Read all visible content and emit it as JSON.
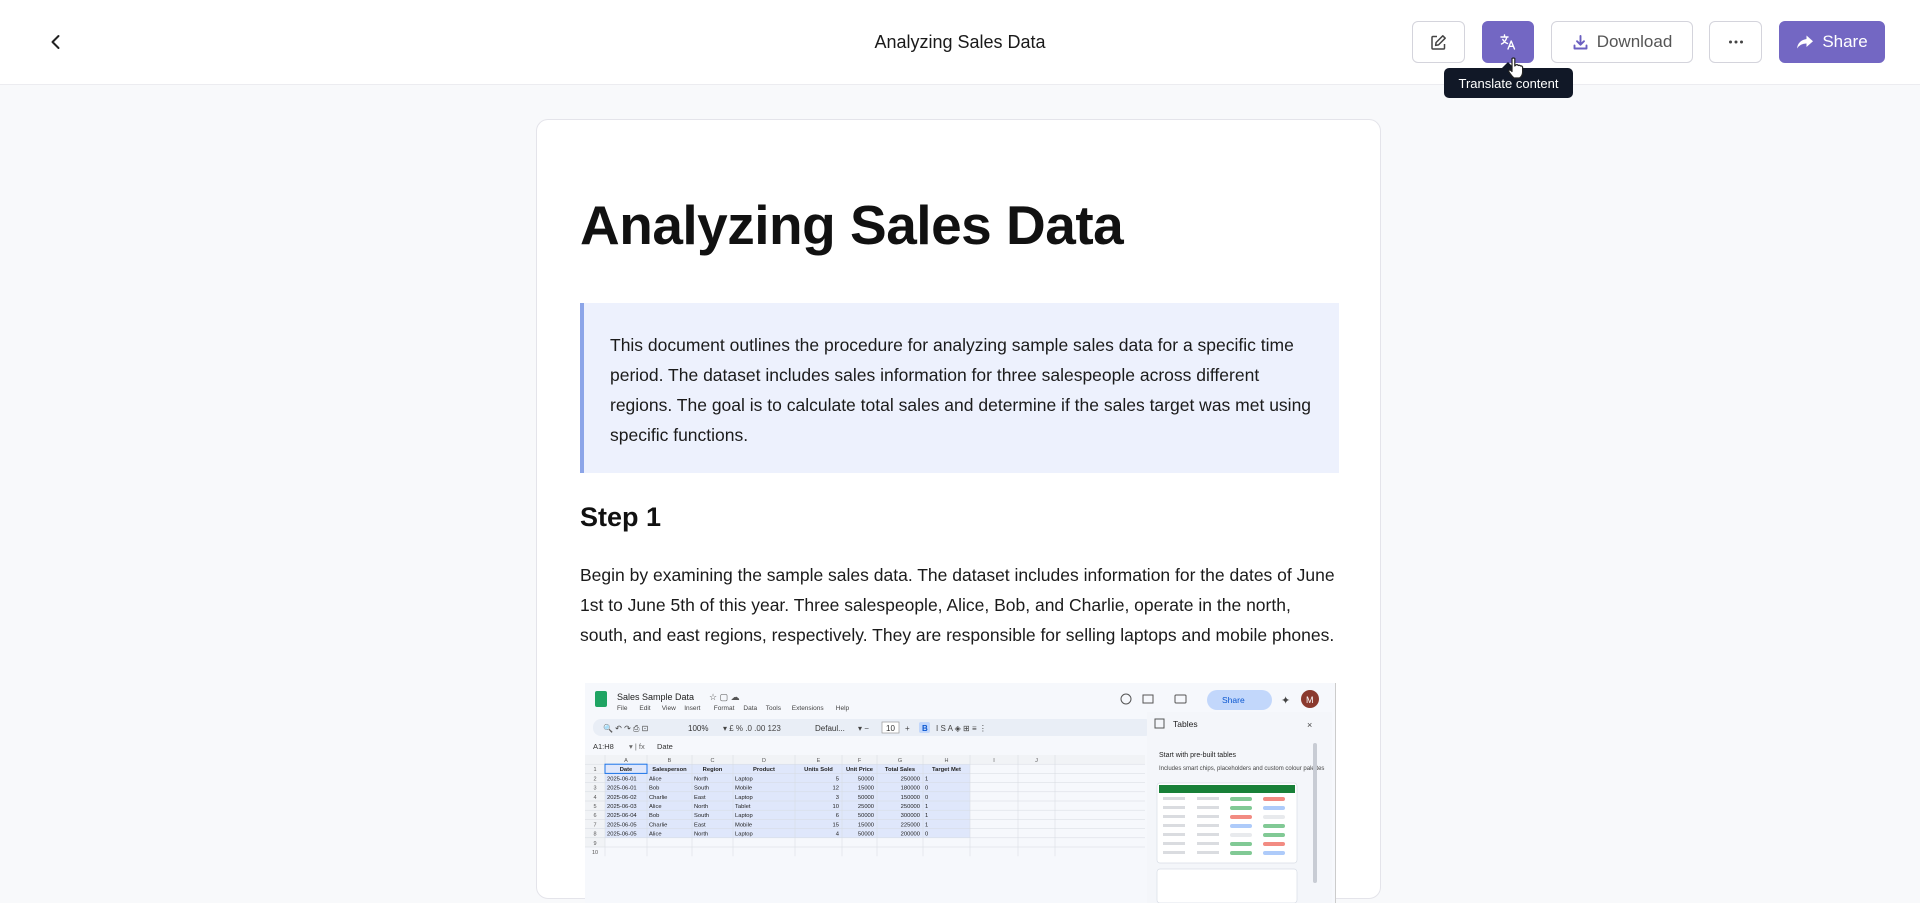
{
  "header": {
    "title": "Analyzing Sales Data",
    "download_label": "Download",
    "share_label": "Share",
    "tooltip": "Translate content"
  },
  "colors": {
    "accent": "#7367c3",
    "callout_bg": "#edf1fd",
    "callout_border": "#8ca5e8",
    "tooltip_bg": "#111827"
  },
  "icons": [
    "chevron-left-icon",
    "edit-icon",
    "translate-icon",
    "download-icon",
    "more-icon",
    "share-icon",
    "cursor-icon"
  ],
  "doc": {
    "title": "Analyzing Sales Data",
    "intro": "This document outlines the procedure for analyzing sample sales data for a specific time period. The dataset includes sales information for three salespeople across different regions. The goal is to calculate total sales and determine if the sales target was met using specific functions.",
    "step1_heading": "Step 1",
    "step1_text": "Begin by examining the sample sales data. The dataset includes information for the dates of June 1st to June 5th of this year. Three salespeople, Alice, Bob, and Charlie, operate in the north, south, and east regions, respectively. They are responsible for selling laptops and mobile phones."
  },
  "screenshot": {
    "file_title": "Sales Sample Data",
    "menu": [
      "File",
      "Edit",
      "View",
      "Insert",
      "Format",
      "Data",
      "Tools",
      "Extensions",
      "Help"
    ],
    "zoom": "100%",
    "font": "Defaul...",
    "font_size": "10",
    "cell_ref": "A1:H8",
    "formula": "Date",
    "share": "Share",
    "avatar": "M",
    "col_letters": [
      "A",
      "B",
      "C",
      "D",
      "E",
      "F",
      "G",
      "H",
      "I",
      "J"
    ],
    "headers": [
      "Date",
      "Salesperson",
      "Region",
      "Product",
      "Units Sold",
      "Unit Price",
      "Total Sales",
      "Target Met"
    ],
    "rows": [
      [
        "2025-06-01",
        "Alice",
        "North",
        "Laptop",
        "5",
        "50000",
        "250000",
        "1"
      ],
      [
        "2025-06-01",
        "Bob",
        "South",
        "Mobile",
        "12",
        "15000",
        "180000",
        "0"
      ],
      [
        "2025-06-02",
        "Charlie",
        "East",
        "Laptop",
        "3",
        "50000",
        "150000",
        "0"
      ],
      [
        "2025-06-03",
        "Alice",
        "North",
        "Tablet",
        "10",
        "25000",
        "250000",
        "1"
      ],
      [
        "2025-06-04",
        "Bob",
        "South",
        "Laptop",
        "6",
        "50000",
        "300000",
        "1"
      ],
      [
        "2025-06-05",
        "Charlie",
        "East",
        "Mobile",
        "15",
        "15000",
        "225000",
        "1"
      ],
      [
        "2025-06-05",
        "Alice",
        "North",
        "Laptop",
        "4",
        "50000",
        "200000",
        "0"
      ]
    ],
    "panel_title": "Tables",
    "panel_heading": "Start with pre-built tables",
    "panel_desc": "Includes smart chips, placeholders and custom colour palettes"
  }
}
